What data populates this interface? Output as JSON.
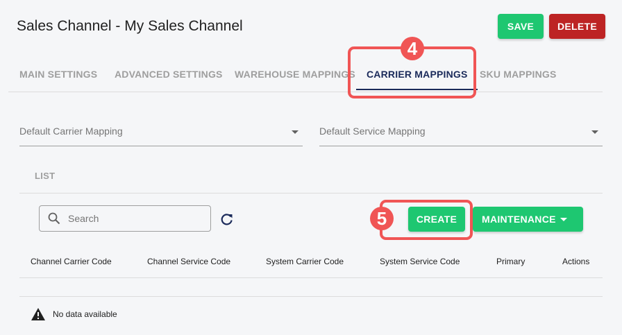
{
  "header": {
    "title": "Sales Channel - My Sales Channel",
    "save_label": "SAVE",
    "delete_label": "DELETE"
  },
  "tabs": [
    {
      "label": "MAIN SETTINGS",
      "active": false
    },
    {
      "label": "ADVANCED SETTINGS",
      "active": false
    },
    {
      "label": "WAREHOUSE MAPPINGS",
      "active": false
    },
    {
      "label": "CARRIER MAPPINGS",
      "active": true
    },
    {
      "label": "SKU MAPPINGS",
      "active": false
    }
  ],
  "callouts": {
    "step4": "4",
    "step5": "5",
    "color": "#f05555"
  },
  "mappings": {
    "default_carrier_label": "Default Carrier Mapping",
    "default_service_label": "Default Service Mapping"
  },
  "list": {
    "label": "LIST",
    "search_placeholder": "Search",
    "create_label": "CREATE",
    "maintenance_label": "MAINTENANCE",
    "columns": [
      "Channel Carrier Code",
      "Channel Service Code",
      "System Carrier Code",
      "System Service Code",
      "Primary",
      "Actions"
    ],
    "empty_text": "No data available"
  },
  "colors": {
    "primary_green": "#1ec771",
    "danger_red": "#bd2424",
    "active_tab": "#1a2a5a"
  }
}
